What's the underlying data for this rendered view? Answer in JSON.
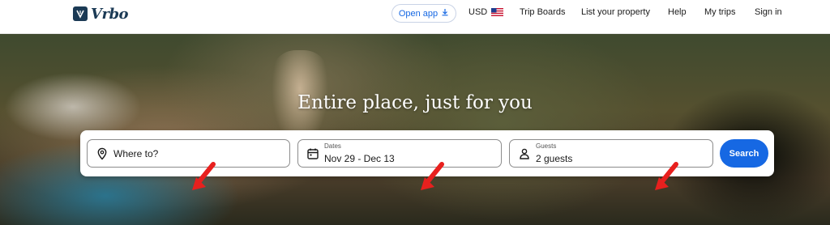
{
  "header": {
    "logo_text": "Vrbo",
    "open_app": "Open app",
    "currency": "USD",
    "nav": {
      "trip_boards": "Trip Boards",
      "list_property": "List your property",
      "help": "Help",
      "my_trips": "My trips",
      "sign_in": "Sign in"
    }
  },
  "hero": {
    "title": "Entire place, just for you"
  },
  "search": {
    "where_placeholder": "Where to?",
    "dates_label": "Dates",
    "dates_value": "Nov 29 - Dec 13",
    "guests_label": "Guests",
    "guests_value": "2 guests",
    "button": "Search"
  },
  "colors": {
    "brand": "#1b3a55",
    "accent": "#1668e3",
    "annotation_arrow": "#e8201e"
  },
  "icons": [
    "download-icon",
    "us-flag-icon",
    "location-pin-icon",
    "calendar-icon",
    "person-icon",
    "red-arrow-annotation"
  ]
}
